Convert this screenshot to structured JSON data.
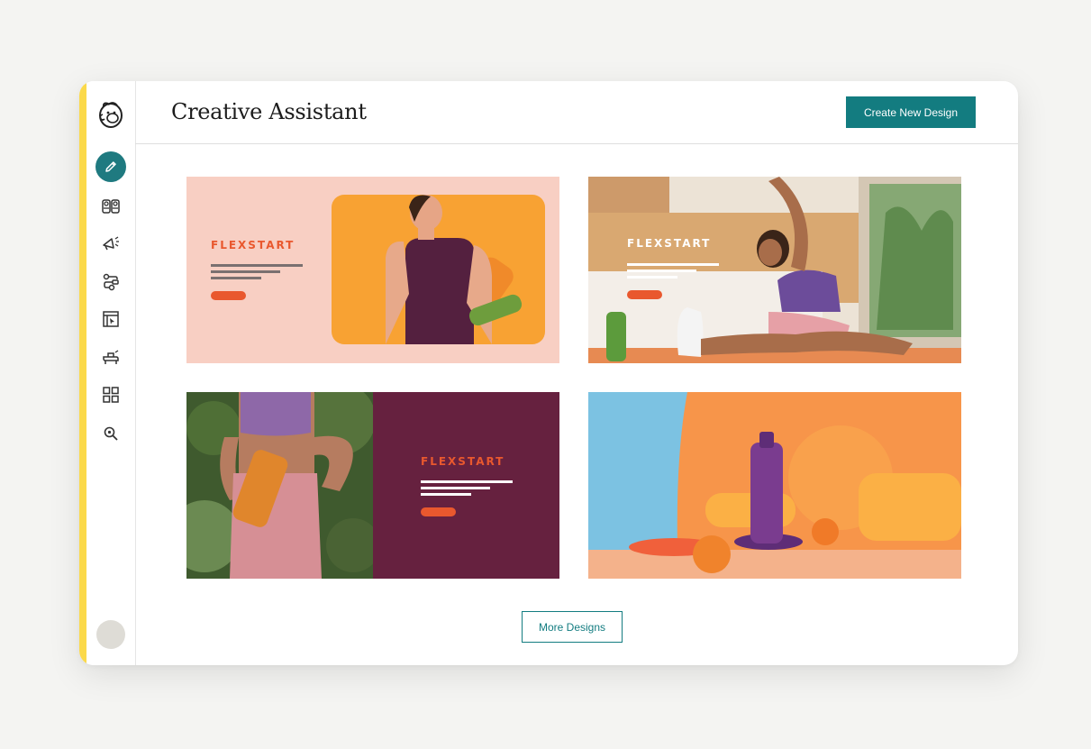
{
  "app": {
    "logo": "mailchimp-freddie-logo",
    "accent_color": "#137c80",
    "sidebar_accent_color": "#fbd94a"
  },
  "sidebar": {
    "items": [
      {
        "icon": "pencil-icon",
        "active": true
      },
      {
        "icon": "audience-icon",
        "active": false
      },
      {
        "icon": "campaign-megaphone-icon",
        "active": false
      },
      {
        "icon": "automation-icon",
        "active": false
      },
      {
        "icon": "website-icon",
        "active": false
      },
      {
        "icon": "content-studio-icon",
        "active": false
      },
      {
        "icon": "integrations-grid-icon",
        "active": false
      },
      {
        "icon": "search-icon",
        "active": false
      }
    ],
    "avatar": "user-avatar"
  },
  "header": {
    "title": "Creative Assistant",
    "create_button": "Create New Design"
  },
  "designs": [
    {
      "brand": "FLEXSTART",
      "brand_color": "#e9582e",
      "background": "#f8cfc3"
    },
    {
      "brand": "FLEXSTART",
      "brand_color": "#ffffff",
      "background": "photo"
    },
    {
      "brand": "FLEXSTART",
      "brand_color": "#e9582e",
      "background": "#66213f"
    },
    {
      "brand": "",
      "background": "photo"
    }
  ],
  "footer": {
    "more_button": "More Designs"
  }
}
